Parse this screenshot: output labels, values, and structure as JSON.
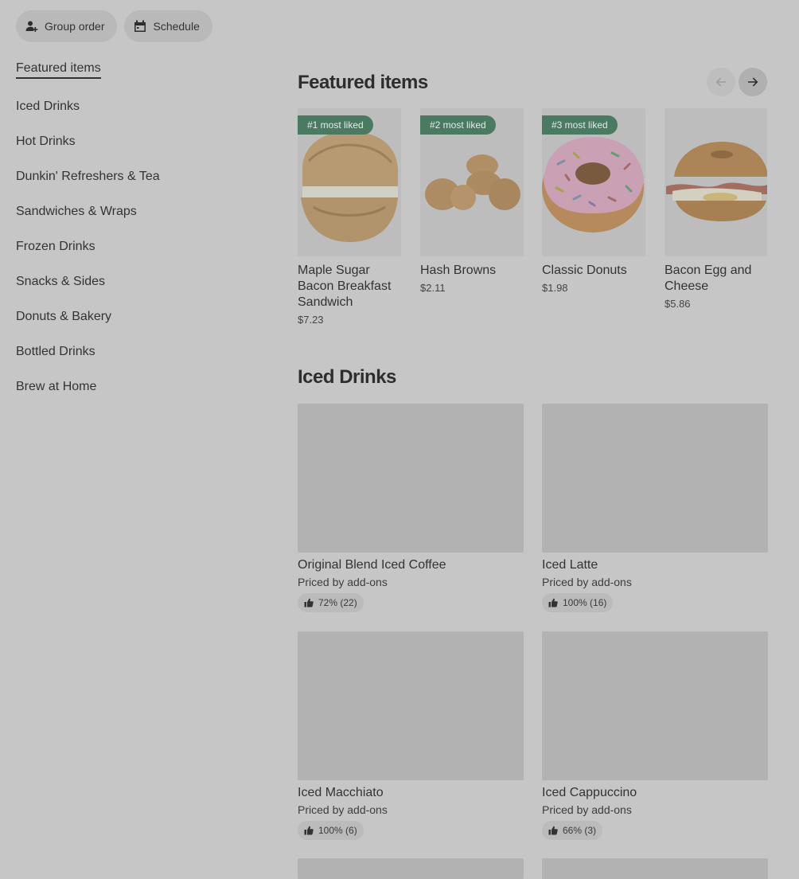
{
  "toolbar": {
    "group_order": "Group order",
    "schedule": "Schedule"
  },
  "sidebar": {
    "items": [
      "Featured items",
      "Iced Drinks",
      "Hot Drinks",
      "Dunkin' Refreshers & Tea",
      "Sandwiches & Wraps",
      "Frozen Drinks",
      "Snacks & Sides",
      "Donuts & Bakery",
      "Bottled Drinks",
      "Brew at Home"
    ]
  },
  "featured": {
    "title": "Featured items",
    "items": [
      {
        "badge": "#1 most liked",
        "name": "Maple Sugar Bacon Breakfast Sandwich",
        "price": "$7.23"
      },
      {
        "badge": "#2 most liked",
        "name": "Hash Browns",
        "price": "$2.11"
      },
      {
        "badge": "#3 most liked",
        "name": "Classic Donuts",
        "price": "$1.98"
      },
      {
        "badge": "",
        "name": "Bacon Egg and Cheese",
        "price": "$5.86"
      }
    ]
  },
  "iced": {
    "title": "Iced Drinks",
    "items": [
      {
        "name": "Original Blend Iced Coffee",
        "sub": "Priced by add-ons",
        "rating": "72% (22)"
      },
      {
        "name": "Iced Latte",
        "sub": "Priced by add-ons",
        "rating": "100% (16)"
      },
      {
        "name": "Iced Macchiato",
        "sub": "Priced by add-ons",
        "rating": "100% (6)"
      },
      {
        "name": "Iced Cappuccino",
        "sub": "Priced by add-ons",
        "rating": "66% (3)"
      }
    ]
  },
  "icons": {
    "group_order": "person-add-icon",
    "schedule": "calendar-icon",
    "prev": "arrow-left-icon",
    "next": "arrow-right-icon",
    "rating": "thumbs-up-icon"
  },
  "colors": {
    "badge_bg": "#4b7a63",
    "overlay_bg": "#c6c6c6"
  }
}
